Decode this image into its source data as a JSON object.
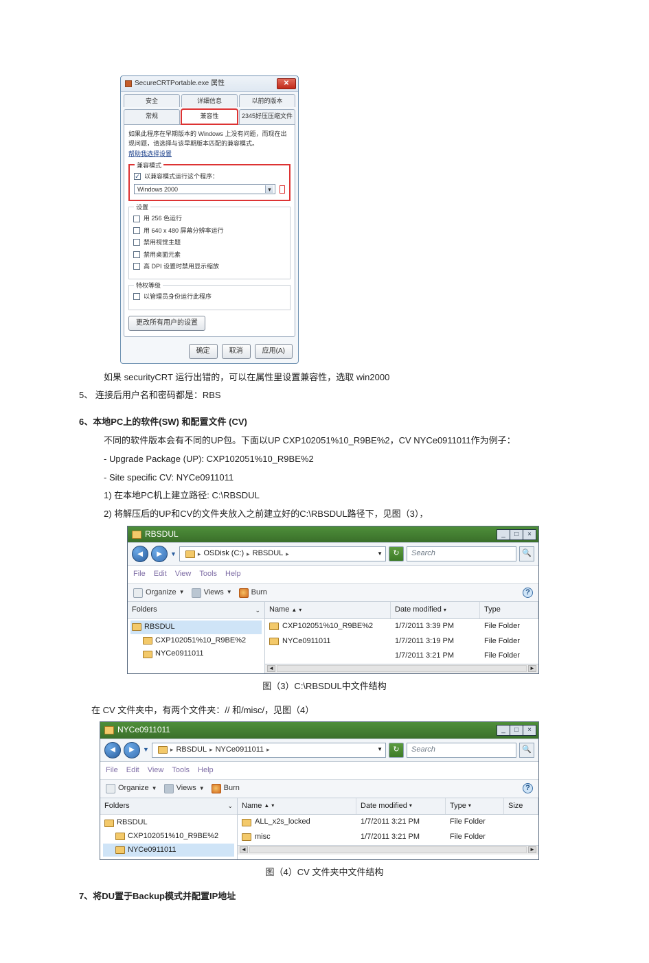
{
  "propsDialog": {
    "title": "SecureCRTPortable.exe 属性",
    "tabs_row1": [
      "安全",
      "详细信息",
      "以前的版本"
    ],
    "tabs_row2": [
      "常规",
      "兼容性",
      "2345好压压缩文件"
    ],
    "intro": "如果此程序在早期版本的 Windows 上没有问题，而现在出现问题，请选择与该早期版本匹配的兼容模式。",
    "help_link": "帮助我选择设置",
    "compat_legend": "兼容模式",
    "compat_checkbox": "以兼容模式运行这个程序：",
    "compat_select": "Windows 2000",
    "settings_legend": "设置",
    "set_1": "用 256 色运行",
    "set_2": "用 640 x 480 屏幕分辨率运行",
    "set_3": "禁用视觉主题",
    "set_4": "禁用桌面元素",
    "set_5": "高 DPI 设置时禁用显示缩放",
    "priv_legend": "特权等级",
    "priv_checkbox": "以管理员身份运行此程序",
    "change_all_btn": "更改所有用户的设置",
    "ok_btn": "确定",
    "cancel_btn": "取消",
    "apply_btn": "应用(A)"
  },
  "text": {
    "afterProps": "如果 securityCRT 运行出错的，可以在属性里设置兼容性，选取 win2000",
    "p5": "5、 连接后用户名和密码都是：RBS",
    "p6": "6、本地PC上的软件(SW)  和配置文件  (CV)",
    "p6a": "不同的软件版本会有不同的UP包。下面以UP  CXP102051%10_R9BE%2，CV NYCe0911011作为例子：",
    "p6b1": "- Upgrade  Package  (UP):  CXP102051%10_R9BE%2",
    "p6b2": "- Site  specific  CV:  NYCe0911011",
    "p6c": "1)  在本地PC机上建立路径:  C:\\RBSDUL",
    "p6d": "2)  将解压后的UP和CV的文件夹放入之前建立好的C:\\RBSDUL路径下，见图（3），",
    "cap3": "图（3）C:\\RBSDUL中文件结构",
    "cvLine": "在 CV 文件夹中，有两个文件夹：//                和/misc/，见图（4）",
    "cap4": "图（4）CV 文件夹中文件结构",
    "p7": "7、将DU置于Backup模式并配置IP地址"
  },
  "explorerCommon": {
    "minimize": "_",
    "maximize": "□",
    "close": "×",
    "searchPlaceholder": "Search",
    "menus": [
      "File",
      "Edit",
      "View",
      "Tools",
      "Help"
    ],
    "organize": "Organize",
    "views": "Views",
    "burn": "Burn",
    "foldersLabel": "Folders",
    "nameHdr": "Name",
    "dateHdr": "Date modified",
    "typeHdr": "Type",
    "sizeHdr": "Size"
  },
  "explorer1": {
    "title": "RBSDUL",
    "crumbs": [
      "OSDisk (C:)",
      "RBSDUL"
    ],
    "tree": [
      {
        "label": "RBSDUL",
        "indent": 0,
        "selected": true
      },
      {
        "label": "CXP102051%10_R9BE%2",
        "indent": 1,
        "selected": false
      },
      {
        "label": "NYCe0911011",
        "indent": 1,
        "selected": false
      }
    ],
    "rows": [
      {
        "name": "CXP102051%10_R9BE%2",
        "date": "1/7/2011 3:39 PM",
        "type": "File Folder"
      },
      {
        "name": "NYCe0911011",
        "date": "1/7/2011 3:19 PM",
        "type": "File Folder"
      },
      {
        "name": "",
        "date": "1/7/2011 3:21 PM",
        "type": "File Folder"
      }
    ]
  },
  "explorer2": {
    "title": "NYCe0911011",
    "crumbs": [
      "RBSDUL",
      "NYCe0911011"
    ],
    "tree": [
      {
        "label": "RBSDUL",
        "indent": 0,
        "selected": false
      },
      {
        "label": "CXP102051%10_R9BE%2",
        "indent": 1,
        "selected": false
      },
      {
        "label": "NYCe0911011",
        "indent": 1,
        "selected": true
      }
    ],
    "rows": [
      {
        "name": "ALL_x2s_locked",
        "date": "1/7/2011 3:21 PM",
        "type": "File Folder"
      },
      {
        "name": "misc",
        "date": "1/7/2011 3:21 PM",
        "type": "File Folder"
      }
    ],
    "showSize": true
  }
}
